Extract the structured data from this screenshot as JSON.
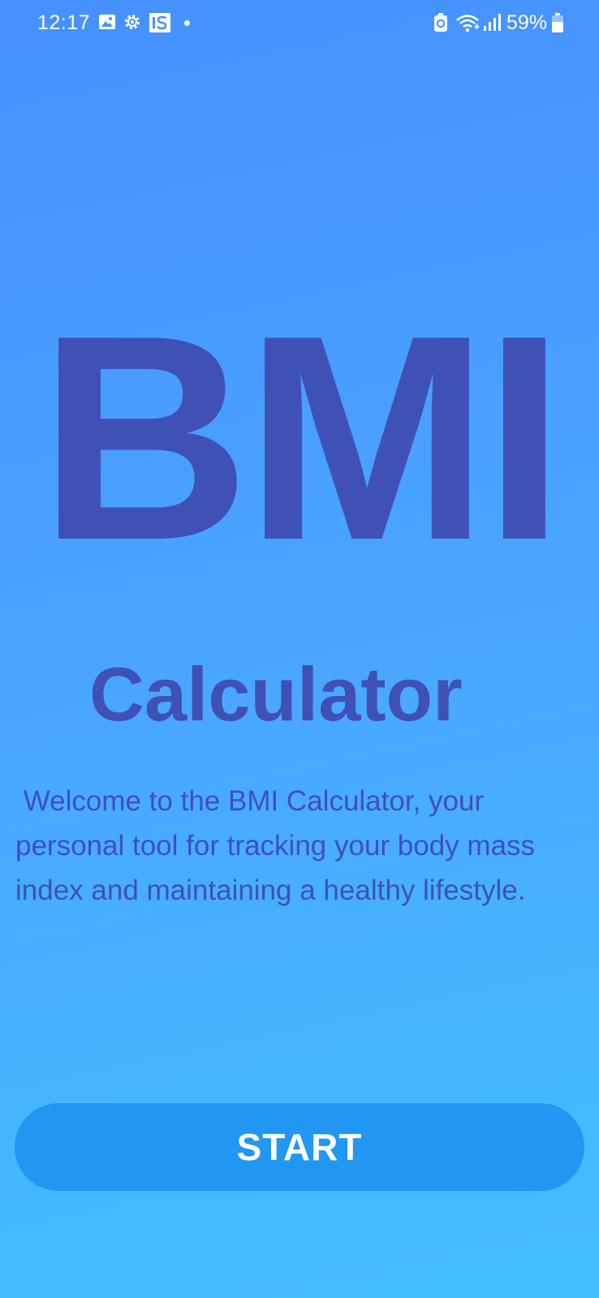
{
  "status_bar": {
    "time": "12:17",
    "battery_percent": "59%",
    "notification_badge": "IS",
    "icons": [
      "gallery-icon",
      "settings-icon",
      "is-app-icon",
      "dot-icon",
      "battery-saver-icon",
      "wifi-icon",
      "signal-icon",
      "battery-icon"
    ]
  },
  "main": {
    "title": "BMI",
    "subtitle": "Calculator",
    "welcome_text": " Welcome to the BMI Calculator, your personal tool for tracking your body mass index and maintaining a healthy lifestyle."
  },
  "actions": {
    "start_label": "START"
  },
  "colors": {
    "background_top": "#4690FF",
    "background_bottom": "#42C0FF",
    "text_primary": "#3F51B5",
    "button": "#2196F3",
    "button_text": "#FFFFFF"
  }
}
